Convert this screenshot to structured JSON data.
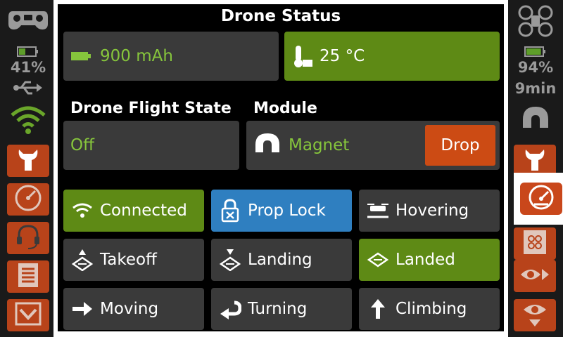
{
  "left_rail": {
    "battery_percent_text": "41%",
    "battery_level": 0.41,
    "icons": [
      "gamepad-icon",
      "battery-icon",
      "usb-icon",
      "wifi-icon"
    ],
    "nav": [
      "wrench-icon",
      "gauge-icon",
      "headset-icon",
      "document-icon",
      "download-icon"
    ]
  },
  "right_rail": {
    "battery_percent_text": "94%",
    "battery_level": 0.94,
    "time_remaining": "9min",
    "icons": [
      "drone-icon",
      "battery-icon",
      "magnet-icon"
    ],
    "nav": [
      "wrench-icon",
      "gauge-icon",
      "drone-checklist-icon",
      "eye-icon",
      "eye-download-icon"
    ]
  },
  "main": {
    "title": "Drone Status",
    "battery_capacity": "900 mAh",
    "temperature": "25 °C",
    "flight_state_label": "Drone Flight State",
    "flight_state_value": "Off",
    "module_label": "Module",
    "module_value": "Magnet",
    "drop_label": "Drop",
    "tiles": [
      {
        "label": "Connected",
        "state": "active-green",
        "icon": "wifi-icon"
      },
      {
        "label": "Prop Lock",
        "state": "active-blue",
        "icon": "prop-lock-icon"
      },
      {
        "label": "Hovering",
        "state": "inactive",
        "icon": "hover-icon"
      },
      {
        "label": "Takeoff",
        "state": "inactive",
        "icon": "takeoff-icon"
      },
      {
        "label": "Landing",
        "state": "inactive",
        "icon": "landing-icon"
      },
      {
        "label": "Landed",
        "state": "active-green",
        "icon": "landed-icon"
      },
      {
        "label": "Moving",
        "state": "inactive",
        "icon": "arrow-right-icon"
      },
      {
        "label": "Turning",
        "state": "inactive",
        "icon": "turn-icon"
      },
      {
        "label": "Climbing",
        "state": "inactive",
        "icon": "arrow-up-icon"
      }
    ]
  },
  "colors": {
    "accent_orange": "#b8431a",
    "active_green": "#5e8a15",
    "active_blue": "#2f7fc0",
    "value_green": "#86c53c",
    "card_gray": "#3a3a3a"
  }
}
